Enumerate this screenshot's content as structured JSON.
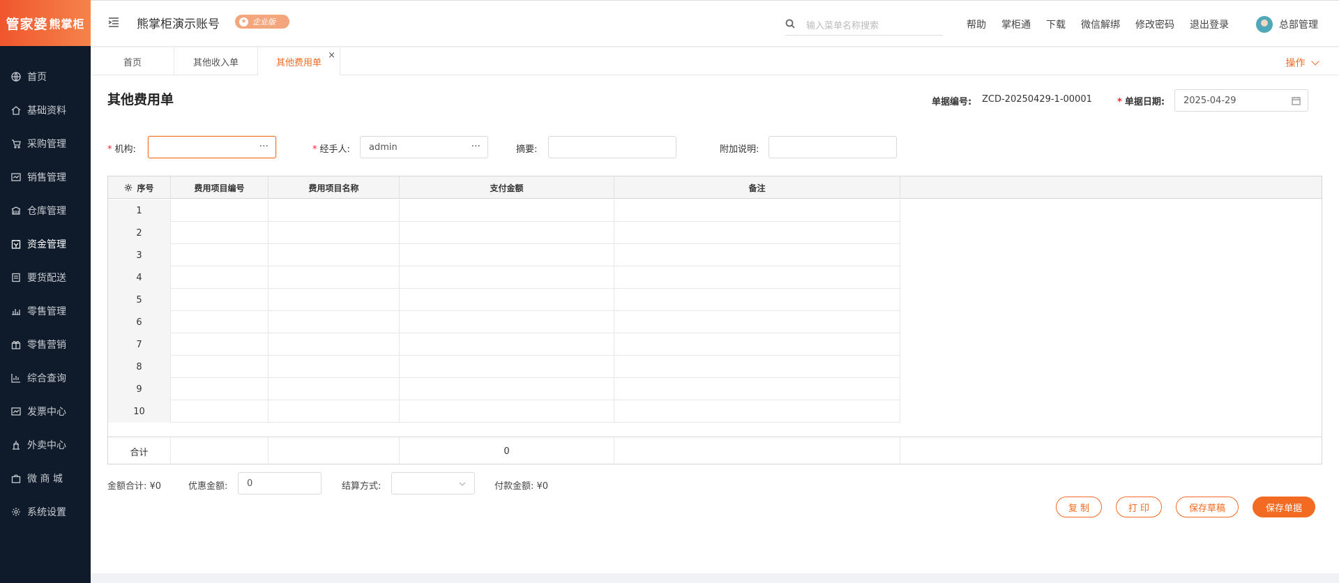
{
  "logo": {
    "main": "管家婆",
    "sub": "熊掌柜"
  },
  "sidebar": {
    "items": [
      {
        "label": "首页",
        "icon": "globe-icon"
      },
      {
        "label": "基础资料",
        "icon": "home-icon"
      },
      {
        "label": "采购管理",
        "icon": "cart-icon"
      },
      {
        "label": "销售管理",
        "icon": "sales-icon"
      },
      {
        "label": "仓库管理",
        "icon": "warehouse-icon"
      },
      {
        "label": "资金管理",
        "icon": "funds-icon"
      },
      {
        "label": "要货配送",
        "icon": "delivery-icon"
      },
      {
        "label": "零售管理",
        "icon": "retail-icon"
      },
      {
        "label": "零售营销",
        "icon": "gift-icon"
      },
      {
        "label": "综合查询",
        "icon": "chart-icon"
      },
      {
        "label": "发票中心",
        "icon": "invoice-icon"
      },
      {
        "label": "外卖中心",
        "icon": "takeout-icon"
      },
      {
        "label": "微 商 城",
        "icon": "shop-icon"
      },
      {
        "label": "系统设置",
        "icon": "settings-icon"
      }
    ]
  },
  "header": {
    "account": "熊掌柜演示账号",
    "edition": "企业版",
    "search_placeholder": "输入菜单名称搜索",
    "links": [
      "帮助",
      "掌柜通",
      "下载",
      "微信解绑",
      "修改密码",
      "退出登录"
    ],
    "user": "总部管理"
  },
  "tabs": [
    {
      "label": "首页"
    },
    {
      "label": "其他收入单"
    },
    {
      "label": "其他费用单"
    }
  ],
  "tab_close": "×",
  "ops_label": "操作",
  "form": {
    "title": "其他费用单",
    "doc_no_label": "单据编号:",
    "doc_no": "ZCD-20250429-1-00001",
    "date_label": "单据日期:",
    "date": "2025-04-29",
    "org_label": "机构:",
    "org_value": "",
    "handler_label": "经手人:",
    "handler_value": "admin",
    "summary_label": "摘要:",
    "summary_value": "",
    "note_label": "附加说明:",
    "note_value": "",
    "dots": "···"
  },
  "table": {
    "columns": [
      "序号",
      "费用项目编号",
      "费用项目名称",
      "支付金额",
      "备注"
    ],
    "rows": [
      "1",
      "2",
      "3",
      "4",
      "5",
      "6",
      "7",
      "8",
      "9",
      "10"
    ],
    "total_label": "合计",
    "total_amount": "0"
  },
  "footer": {
    "amount_total_label": "金额合计:",
    "amount_total": "¥0",
    "discount_label": "优惠金额:",
    "discount_value": "0",
    "settle_label": "结算方式:",
    "settle_value": "",
    "pay_label": "付款金额:",
    "pay_value": "¥0"
  },
  "buttons": {
    "copy": "复 制",
    "print": "打 印",
    "draft": "保存草稿",
    "save": "保存单据"
  },
  "colors": {
    "accent": "#f36a22",
    "sidebar_bg": "#0f1b2a"
  }
}
